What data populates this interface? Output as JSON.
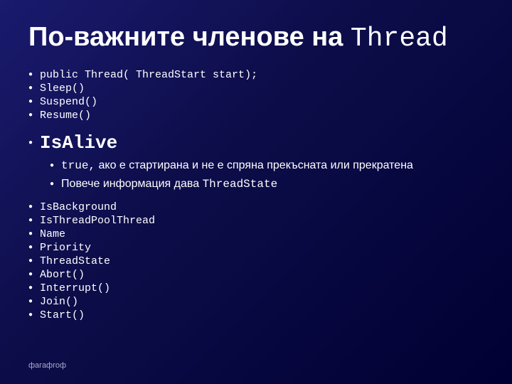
{
  "title": {
    "prefix": "По-важните членове на ",
    "suffix": "Thread"
  },
  "top_bullets": [
    "public Thread( ThreadStart start);",
    "Sleep()",
    "Suspend()",
    "Resume()"
  ],
  "is_alive": {
    "label": "IsAlive",
    "sub_bullets": [
      {
        "mono_part": "true,",
        "text_part": " ако е стартирана и не е спряна прекъсната или прекратена"
      },
      {
        "mono_part": "",
        "text_part": "Повече информация дава ",
        "mono_end": "ThreadState"
      }
    ]
  },
  "bottom_bullets": [
    "IsBackground",
    "IsThreadPoolThread",
    "Name",
    "Priority",
    "ThreadState",
    "Abort()",
    "Interrupt()",
    "Join()",
    "Start()"
  ],
  "footer": "фагафгоф"
}
